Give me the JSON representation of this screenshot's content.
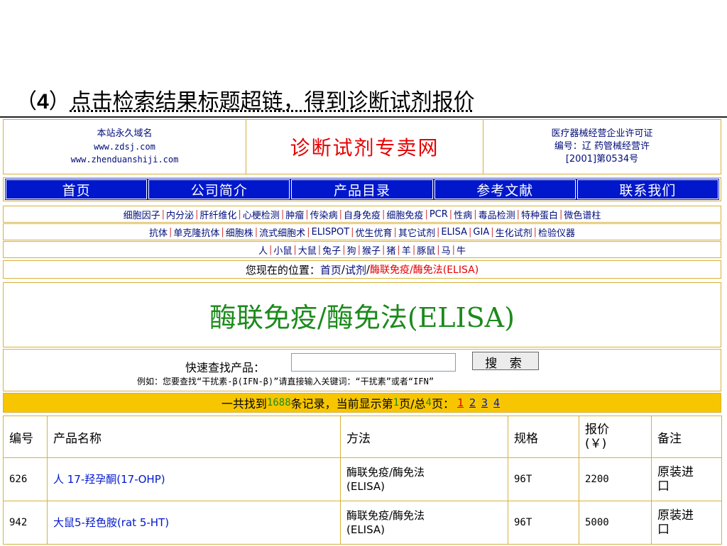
{
  "caption": {
    "num": "4",
    "text": "点击检索结果标题超链，得到诊断试剂报价"
  },
  "header": {
    "left_line1": "本站永久域名",
    "left_line2": "www.zdsj.com",
    "left_line3": "www.zhenduanshiji.com",
    "site_title": "诊断试剂专卖网",
    "right_line1": "医疗器械经营企业许可证",
    "right_line2": "编号：辽 药管械经营许",
    "right_line3": "[2001]第0534号"
  },
  "nav": [
    "首页",
    "公司简介",
    "产品目录",
    "参考文献",
    "联系我们"
  ],
  "categories_row1": [
    "细胞因子",
    "内分泌",
    "肝纤维化",
    "心梗检测",
    "肿瘤",
    "传染病",
    "自身免疫",
    "细胞免疫",
    "PCR",
    "性病",
    "毒品检测",
    "特种蛋白",
    "微色谱柱"
  ],
  "categories_row2": [
    "抗体",
    "单克隆抗体",
    "细胞株",
    "流式细胞术",
    "ELISPOT",
    "优生优育",
    "其它试剂",
    "ELISA",
    "GIA",
    "生化试剂",
    "检验仪器"
  ],
  "species_row": [
    "人",
    "小鼠",
    "大鼠",
    "兔子",
    "狗",
    "猴子",
    "猪",
    "羊",
    "豚鼠",
    "马",
    "牛"
  ],
  "breadcrumb": {
    "prefix": "您现在的位置：",
    "home": "首页",
    "sep1": "/",
    "level2": "试剂",
    "sep2": "/",
    "current": "酶联免疫/酶免法(ELISA)"
  },
  "page_title": "酶联免疫/酶免法(ELISA)",
  "search": {
    "label": "快速查找产品：",
    "value": "",
    "button": "搜 索",
    "example": "例如：您要查找“干扰素-β(IFN-β)”请直接输入关键词：“干扰素”或者“IFN”"
  },
  "results": {
    "prefix": "一共找到",
    "total": "1688",
    "mid1": "条记录，当前显示第",
    "current_page": "1",
    "mid2": "页/总",
    "total_pages": "4",
    "mid3": "页：",
    "pages": [
      "1",
      "2",
      "3",
      "4"
    ]
  },
  "table": {
    "headers": [
      "编号",
      "产品名称",
      "方法",
      "规格",
      "报价\n(￥)",
      "备注"
    ],
    "rows": [
      [
        "626",
        "人 17-羟孕酮(17-OHP)",
        "酶联免疫/酶免法\n(ELISA)",
        "96T",
        "2200",
        "原装进\n口"
      ],
      [
        "942",
        "大鼠5-羟色胺(rat 5-HT)",
        "酶联免疫/酶免法\n(ELISA)",
        "96T",
        "5000",
        "原装进\n口"
      ]
    ]
  }
}
